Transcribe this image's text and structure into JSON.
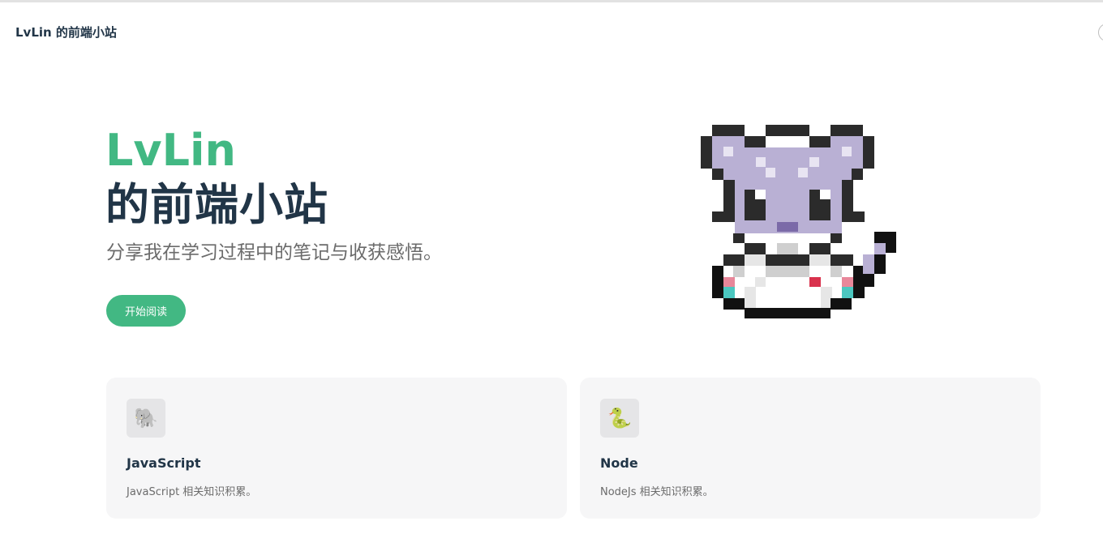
{
  "nav": {
    "site_title": "LvLin 的前端小站"
  },
  "hero": {
    "name": "LvLin",
    "text": "的前端小站",
    "tagline": "分享我在学习过程中的笔记与收获感悟。",
    "action_label": "开始阅读"
  },
  "features": [
    {
      "icon": "🐘",
      "icon_name": "elephant-icon",
      "title": "JavaScript",
      "details": "JavaScript 相关知识积累。"
    },
    {
      "icon": "🐍",
      "icon_name": "snake-icon",
      "title": "Node",
      "details": "NodeJs 相关知识积累。"
    }
  ],
  "colors": {
    "brand": "#42b883",
    "text": "#213547",
    "muted": "#6b6b6b",
    "card_bg": "#f6f6f7"
  },
  "mascot": {
    "icon_name": "pixel-cat-icon"
  }
}
